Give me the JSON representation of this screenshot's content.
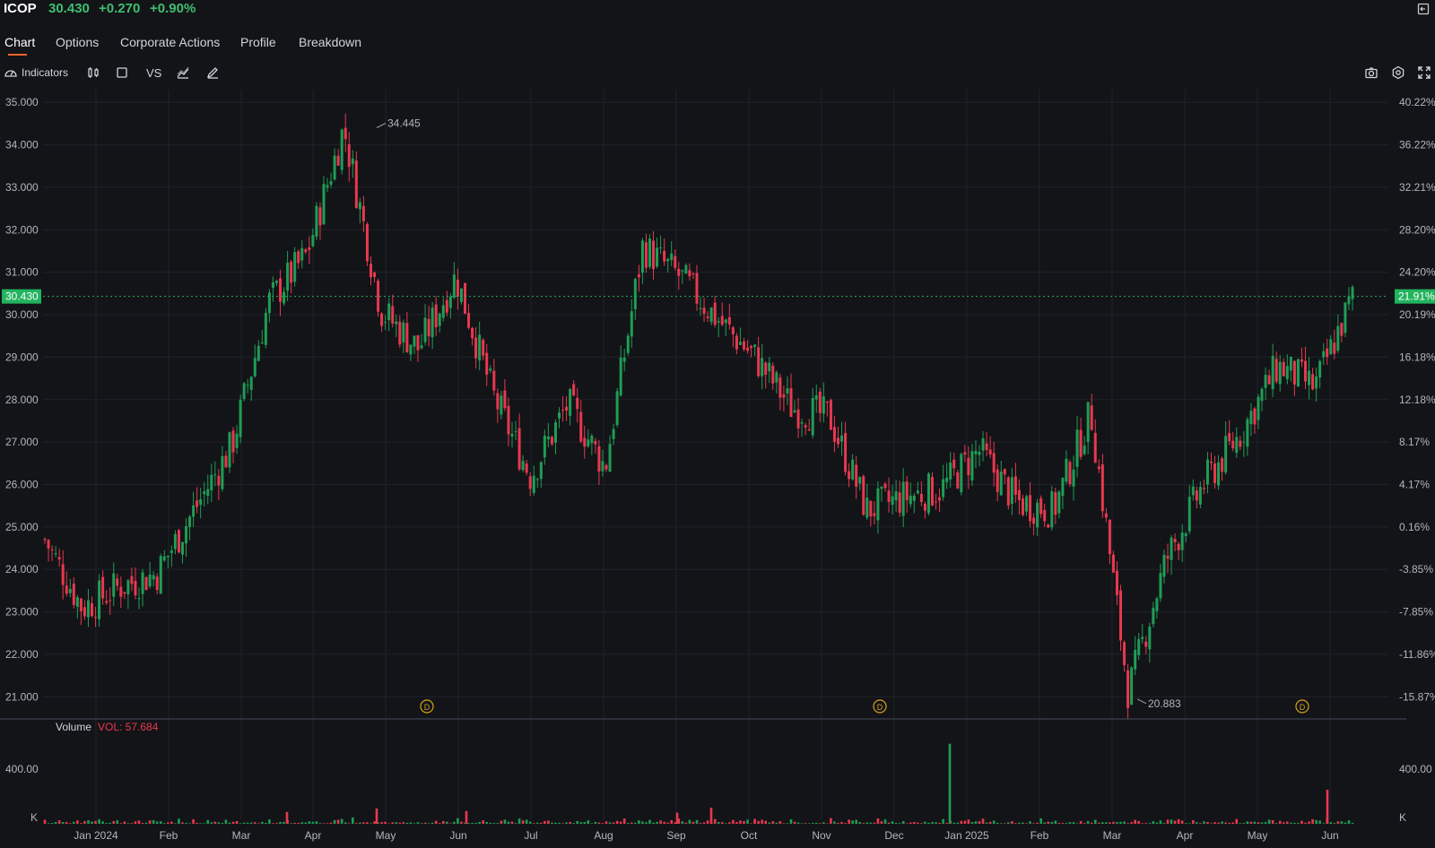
{
  "header": {
    "symbol": "ICOP",
    "price": "30.430",
    "change": "+0.270",
    "change_pct": "+0.90%"
  },
  "tabs": [
    {
      "label": "Chart",
      "active": true
    },
    {
      "label": "Options"
    },
    {
      "label": "Corporate Actions"
    },
    {
      "label": "Profile"
    },
    {
      "label": "Breakdown"
    }
  ],
  "toolbar": {
    "indicators_label": "Indicators",
    "vs_label": "VS",
    "left_icons": [
      "candlestick-type-icon",
      "square-layout-icon",
      "compare-icon",
      "chart-type-icon",
      "draw-pencil-icon"
    ],
    "right_icons": [
      "camera-icon",
      "settings-gear-icon",
      "fullscreen-icon"
    ]
  },
  "colors": {
    "up": "#1f9d55",
    "down": "#e8384f",
    "accent": "#f0642a",
    "background": "#131418"
  },
  "chart_data": {
    "type": "candlestick",
    "y_axis_left": {
      "ticks": [
        "35.000",
        "34.000",
        "33.000",
        "32.000",
        "31.000",
        "30.000",
        "29.000",
        "28.000",
        "27.000",
        "26.000",
        "25.000",
        "24.000",
        "23.000",
        "22.000",
        "21.000"
      ],
      "range": [
        20.5,
        35.3
      ]
    },
    "y_axis_right": {
      "ticks": [
        "40.22%",
        "36.22%",
        "32.21%",
        "28.20%",
        "24.20%",
        "20.19%",
        "16.18%",
        "12.18%",
        "8.17%",
        "4.17%",
        "0.16%",
        "-3.85%",
        "-7.85%",
        "-11.86%",
        "-15.87%"
      ]
    },
    "x_axis_labels": [
      "Jan 2024",
      "Feb",
      "Mar",
      "Apr",
      "May",
      "Jun",
      "Jul",
      "Aug",
      "Sep",
      "Oct",
      "Nov",
      "Dec",
      "Jan 2025",
      "Feb",
      "Mar",
      "Apr",
      "May",
      "Jun"
    ],
    "last_price_label": "30.430",
    "last_pct_label": "21.91%",
    "last_price_value": 30.43,
    "high_annotation": "34.445",
    "low_annotation": "20.883",
    "dividend_marker": "D",
    "dividend_markers_at": [
      "May",
      "Dec",
      "Jun"
    ],
    "grid": true,
    "price_path": [
      [
        "Jan 2024",
        24.7
      ],
      [
        "Jan 2024",
        23.1
      ],
      [
        "Feb",
        23.6
      ],
      [
        "Feb",
        23.9
      ],
      [
        "Mar",
        25.4
      ],
      [
        "Mar",
        26.9
      ],
      [
        "Apr",
        30.3
      ],
      [
        "Apr",
        31.4
      ],
      [
        "May",
        34.4
      ],
      [
        "May",
        30.1
      ],
      [
        "Jun",
        29.2
      ],
      [
        "Jun",
        30.9
      ],
      [
        "Jul",
        28.1
      ],
      [
        "Jul",
        26.2
      ],
      [
        "Aug",
        27.9
      ],
      [
        "Aug",
        26.4
      ],
      [
        "Sep",
        31.6
      ],
      [
        "Sep",
        30.9
      ],
      [
        "Oct",
        29.9
      ],
      [
        "Oct",
        29.0
      ],
      [
        "Nov",
        27.8
      ],
      [
        "Nov",
        27.6
      ],
      [
        "Dec",
        25.4
      ],
      [
        "Dec",
        25.7
      ],
      [
        "Jan 2025",
        25.9
      ],
      [
        "Jan 2025",
        26.8
      ],
      [
        "Feb",
        25.6
      ],
      [
        "Feb",
        25.4
      ],
      [
        "Mar",
        27.7
      ],
      [
        "Mar",
        21.1
      ],
      [
        "Apr",
        24.2
      ],
      [
        "Apr",
        26.0
      ],
      [
        "May",
        27.2
      ],
      [
        "May",
        28.8
      ],
      [
        "Jun",
        28.3
      ],
      [
        "Jun",
        30.4
      ]
    ],
    "volume": {
      "label": "Volume",
      "vol_label": "VOL: 57.684",
      "axis_tick": "400.00",
      "unit": "K",
      "spikes": [
        {
          "x": "Apr",
          "value": 70
        },
        {
          "x": "May",
          "value": 90
        },
        {
          "x": "Jun",
          "value": 75
        },
        {
          "x": "Sep",
          "value": 65
        },
        {
          "x": "Sep",
          "value": 95
        },
        {
          "x": "Jan 2025",
          "value": 470
        },
        {
          "x": "Jun",
          "value": 200
        }
      ]
    }
  }
}
